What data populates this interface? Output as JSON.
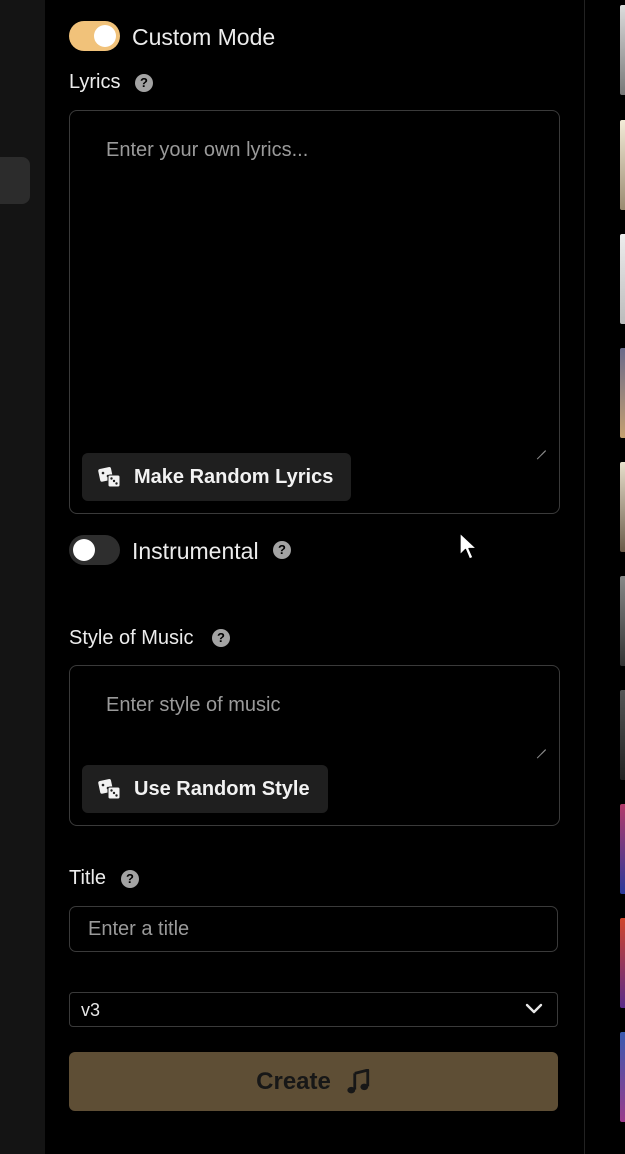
{
  "colors": {
    "accent": "#f1c27a",
    "create_button": "#5e4e35",
    "background": "#000000",
    "border": "#3a3a3a"
  },
  "custom_mode": {
    "label": "Custom Mode",
    "checked": true
  },
  "lyrics": {
    "label": "Lyrics",
    "help_icon": "question-circle-icon",
    "placeholder": "Enter your own lyrics...",
    "value": "",
    "random_button": "Make Random Lyrics",
    "random_icon": "dice-icon"
  },
  "instrumental": {
    "label": "Instrumental",
    "checked": false,
    "help_icon": "question-circle-icon"
  },
  "style": {
    "label": "Style of Music",
    "help_icon": "question-circle-icon",
    "placeholder": "Enter style of music",
    "value": "",
    "random_button": "Use Random Style",
    "random_icon": "dice-icon"
  },
  "title": {
    "label": "Title",
    "help_icon": "question-circle-icon",
    "placeholder": "Enter a title",
    "value": ""
  },
  "model_select": {
    "selected": "v3",
    "icon": "chevron-down-icon"
  },
  "create_button": {
    "label": "Create",
    "icon": "music-note-icon"
  }
}
